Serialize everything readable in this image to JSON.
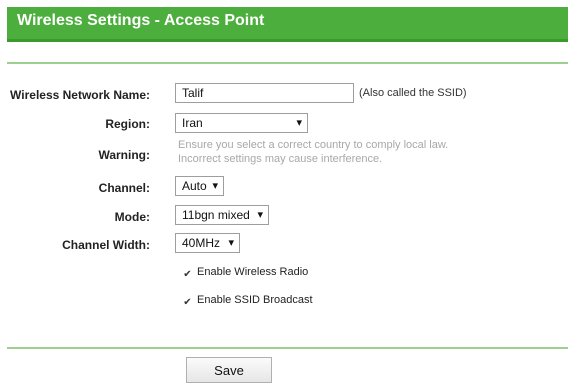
{
  "header": {
    "title": "Wireless Settings - Access Point"
  },
  "form": {
    "ssid": {
      "label": "Wireless Network Name:",
      "value": "Talif",
      "hint": "(Also called the SSID)"
    },
    "region": {
      "label": "Region:",
      "value": "Iran"
    },
    "warning": {
      "label": "Warning:",
      "line1": "Ensure you select a correct country to comply local law.",
      "line2": "Incorrect settings may cause interference."
    },
    "channel": {
      "label": "Channel:",
      "value": "Auto"
    },
    "mode": {
      "label": "Mode:",
      "value": "11bgn mixed"
    },
    "channel_width": {
      "label": "Channel Width:",
      "value": "40MHz"
    },
    "enable_radio": {
      "label": "Enable Wireless Radio",
      "checked": true
    },
    "enable_ssid_broadcast": {
      "label": "Enable SSID Broadcast",
      "checked": true
    }
  },
  "actions": {
    "save_label": "Save"
  }
}
